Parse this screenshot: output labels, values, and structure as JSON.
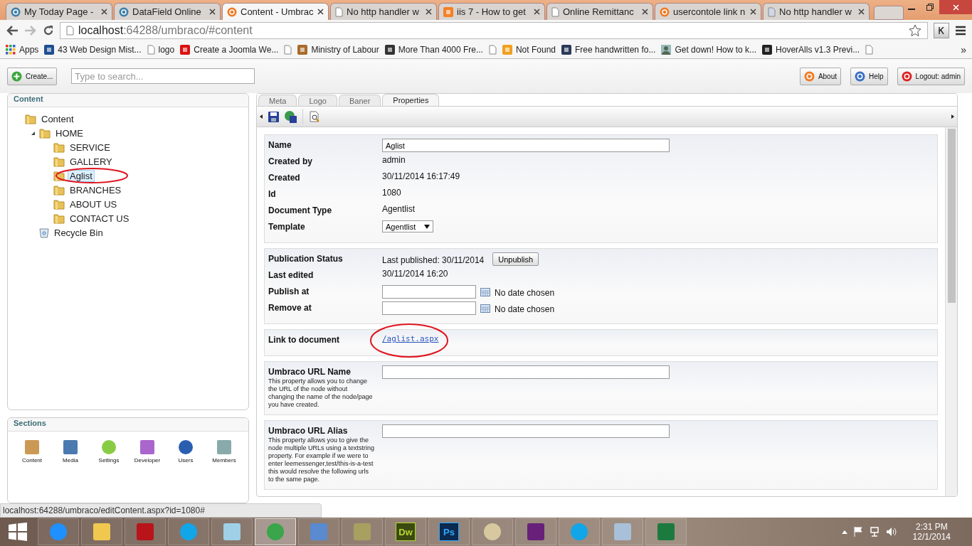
{
  "browser": {
    "tabs": [
      {
        "title": "My Today Page -",
        "kind": "db",
        "selected": false
      },
      {
        "title": "DataField Online",
        "kind": "db",
        "selected": false
      },
      {
        "title": "Content - Umbrac",
        "kind": "umbraco",
        "selected": true
      },
      {
        "title": "No http handler w",
        "kind": "page",
        "selected": false
      },
      {
        "title": "iis 7 - How to get",
        "kind": "stack",
        "selected": false
      },
      {
        "title": "Online Remittanc",
        "kind": "page",
        "selected": false
      },
      {
        "title": "usercontole link n",
        "kind": "heart",
        "selected": false
      },
      {
        "title": "No http handler w",
        "kind": "doc",
        "selected": false
      }
    ],
    "url": {
      "host": "localhost",
      "path": ":64288/umbraco/#content"
    },
    "bookmarks": [
      {
        "label": "Apps",
        "kind": "grid"
      },
      {
        "label": "43 Web Design Mist...",
        "kind": "dbt"
      },
      {
        "label": "logo",
        "kind": "page"
      },
      {
        "label": "Create a Joomla We...",
        "kind": "youtube"
      },
      {
        "kind": "page"
      },
      {
        "label": "Ministry of Labour",
        "kind": "emblem"
      },
      {
        "label": "More Than 4000 Fre...",
        "kind": "joomla"
      },
      {
        "kind": "page"
      },
      {
        "label": "Not Found",
        "kind": "pma"
      },
      {
        "label": "Free handwritten fo...",
        "kind": "f"
      },
      {
        "label": "Get down! How to k...",
        "kind": "avatar"
      },
      {
        "label": "HoverAlls v1.3 Previ...",
        "kind": "bird"
      },
      {
        "kind": "page"
      }
    ],
    "more": "»",
    "status": "localhost:64288/umbraco/editContent.aspx?id=1080#"
  },
  "topbar": {
    "create": "Create...",
    "search_placeholder": "Type to search...",
    "buttons": [
      {
        "label": "About",
        "kind": "umbraco"
      },
      {
        "label": "Help",
        "kind": "help"
      },
      {
        "label": "Logout: admin",
        "kind": "logout"
      }
    ]
  },
  "tree": {
    "title": "Content",
    "items": [
      {
        "label": "Content",
        "kind": "folder",
        "selected": false,
        "children": [
          {
            "label": "HOME",
            "kind": "folder",
            "selected": false,
            "expanded": true,
            "children": [
              {
                "label": "SERVICE",
                "kind": "folder",
                "selected": false
              },
              {
                "label": "GALLERY",
                "kind": "folder",
                "selected": false
              },
              {
                "label": "Aglist",
                "kind": "folder",
                "selected": true,
                "circled": true
              },
              {
                "label": "BRANCHES",
                "kind": "folder",
                "selected": false
              },
              {
                "label": "ABOUT US",
                "kind": "folder",
                "selected": false
              },
              {
                "label": "CONTACT US",
                "kind": "folder",
                "selected": false
              }
            ]
          },
          {
            "label": "Recycle Bin",
            "kind": "bin",
            "selected": false
          }
        ]
      }
    ]
  },
  "sections": {
    "title": "Sections",
    "items": [
      {
        "label": "Content",
        "kind": "pencil"
      },
      {
        "label": "Media",
        "kind": "picture"
      },
      {
        "label": "Settings",
        "kind": "ball"
      },
      {
        "label": "Developer",
        "kind": "wand"
      },
      {
        "label": "Users",
        "kind": "user"
      },
      {
        "label": "Members",
        "kind": "card"
      }
    ]
  },
  "editor": {
    "tabs": [
      {
        "label": "Meta",
        "selected": false
      },
      {
        "label": "Logo",
        "selected": false
      },
      {
        "label": "Baner",
        "selected": false
      },
      {
        "label": "Properties",
        "selected": true
      }
    ],
    "groups": [
      {
        "rows": [
          {
            "kind": "input",
            "label": "Name",
            "value": "Aglist"
          },
          {
            "kind": "text",
            "label": "Created by",
            "value": "admin"
          },
          {
            "kind": "text",
            "label": "Created",
            "value": "30/11/2014 16:17:49"
          },
          {
            "kind": "text",
            "label": "Id",
            "value": "1080"
          },
          {
            "kind": "text",
            "label": "Document Type",
            "value": "Agentlist"
          },
          {
            "kind": "select",
            "label": "Template",
            "value": "Agentlist"
          }
        ]
      },
      {
        "rows": [
          {
            "kind": "button",
            "label": "Publication Status",
            "value": "Last published: 30/11/2014",
            "button": "Unpublish"
          },
          {
            "kind": "text",
            "label": "Last edited",
            "value": "30/11/2014 16:20"
          },
          {
            "kind": "date",
            "label": "Publish at",
            "note": "No date chosen"
          },
          {
            "kind": "date",
            "label": "Remove at",
            "note": "No date chosen"
          }
        ]
      },
      {
        "rows": [
          {
            "kind": "link",
            "label": "Link to document",
            "value": "/aglist.aspx",
            "circled": true
          }
        ]
      },
      {
        "rows": [
          {
            "kind": "input",
            "label": "Umbraco URL Name",
            "description": "This property allows you to change the URL of the node without changing the name of the node/page you have created."
          }
        ]
      },
      {
        "rows": [
          {
            "kind": "input",
            "label": "Umbraco URL Alias",
            "description": "This property allows you to give the node multiple URLs using a textstring property. For example if we were to enter leemessenger,test/this-is-a-test this would resolve the following urls to the same page."
          }
        ]
      }
    ]
  },
  "taskbar": {
    "items": [
      {
        "kind": "ie",
        "active": false
      },
      {
        "kind": "explorer",
        "active": false
      },
      {
        "kind": "filezilla",
        "active": false
      },
      {
        "kind": "skype",
        "active": false
      },
      {
        "kind": "notepad",
        "active": false
      },
      {
        "kind": "chrome",
        "active": true
      },
      {
        "kind": "calculator",
        "active": false
      },
      {
        "kind": "tools",
        "active": false
      },
      {
        "kind": "dw",
        "glyph": "Dw",
        "active": false
      },
      {
        "kind": "ps",
        "glyph": "Ps",
        "active": false
      },
      {
        "kind": "paint",
        "active": false
      },
      {
        "kind": "vs",
        "active": false
      },
      {
        "kind": "skype",
        "active": false
      },
      {
        "kind": "stack",
        "active": false
      },
      {
        "kind": "excel",
        "active": false
      }
    ],
    "time": "2:31 PM",
    "date": "12/1/2014"
  }
}
